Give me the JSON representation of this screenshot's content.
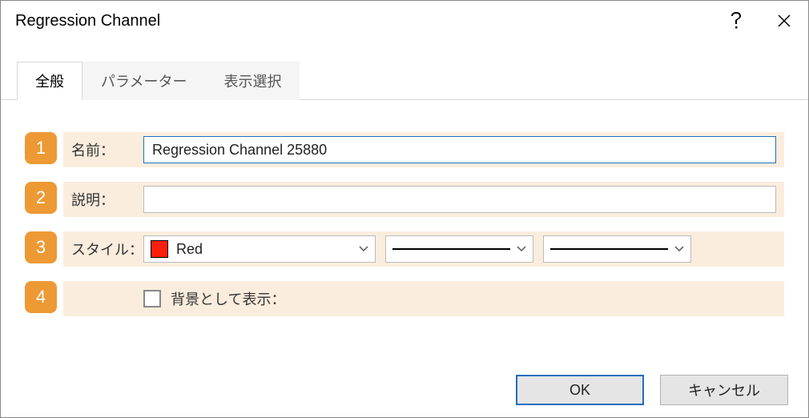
{
  "window": {
    "title": "Regression Channel"
  },
  "tabs": {
    "general": "全般",
    "parameters": "パラメーター",
    "display": "表示選択"
  },
  "rows": {
    "r1": {
      "badge": "1",
      "label": "名前：",
      "value": "Regression Channel 25880"
    },
    "r2": {
      "badge": "2",
      "label": "説明：",
      "value": ""
    },
    "r3": {
      "badge": "3",
      "label": "スタイル：",
      "color_name": "Red"
    },
    "r4": {
      "badge": "4",
      "checkbox_label": "背景として表示："
    }
  },
  "buttons": {
    "ok": "OK",
    "cancel": "キャンセル"
  }
}
